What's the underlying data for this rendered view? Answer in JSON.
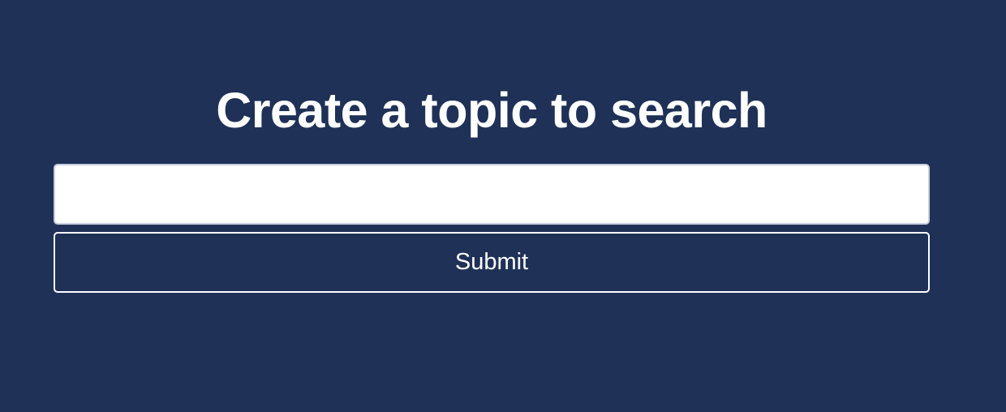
{
  "main": {
    "heading": "Create a topic to search",
    "topic_input": {
      "value": "",
      "placeholder": ""
    },
    "submit_label": "Submit"
  },
  "colors": {
    "background": "#1f3157",
    "text": "#ffffff",
    "input_background": "#ffffff",
    "input_border": "#c7cedc",
    "button_border": "#ffffff"
  }
}
